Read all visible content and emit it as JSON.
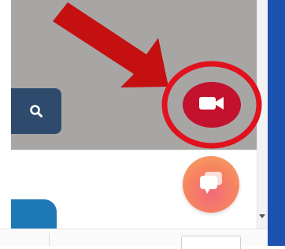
{
  "icons": {
    "search": "search-icon",
    "video": "video-camera-icon",
    "chat": "chat-bubbles-icon",
    "scroll_down": "chevron-down-icon"
  },
  "colors": {
    "overlay_gray": "#a8a6a5",
    "search_button": "#2e4b6e",
    "video_button": "#c2122e",
    "annotation_red": "#e0121e",
    "arrow_red": "#c41010",
    "chat_gradient_start": "#f26b7a",
    "chat_gradient_end": "#f9a86a",
    "right_panel_blue": "#1d51b0",
    "tab_blue": "#1e78b4"
  }
}
